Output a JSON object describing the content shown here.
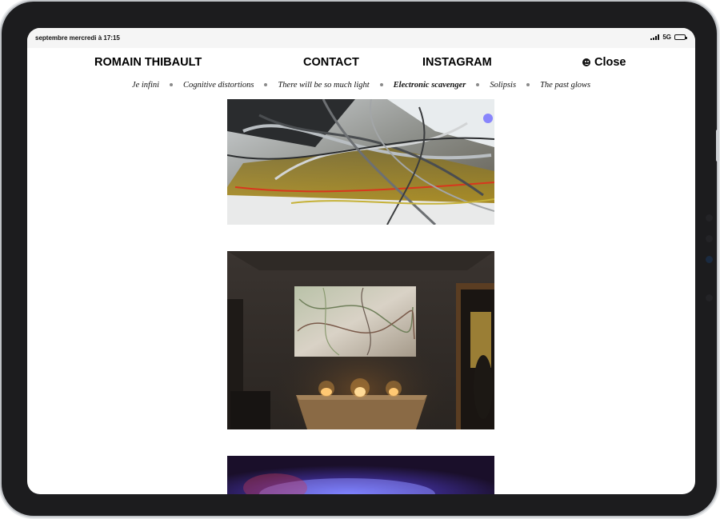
{
  "status_bar": {
    "time": "septembre mercredi à 17:15",
    "network": "5G",
    "icons": [
      "signal-icon",
      "battery-icon"
    ]
  },
  "nav": {
    "brand": "ROMAIN THIBAULT",
    "contact": "CONTACT",
    "instagram": "INSTAGRAM",
    "close_label": "Close",
    "close_icon": "smiley-icon"
  },
  "subnav": {
    "items": [
      {
        "label": "Je infini",
        "active": false
      },
      {
        "label": "Cognitive distortions",
        "active": false
      },
      {
        "label": "There will be so much light",
        "active": false
      },
      {
        "label": "Electronic scavenger",
        "active": true
      },
      {
        "label": "Solipsis",
        "active": false
      },
      {
        "label": "The past glows",
        "active": false
      }
    ]
  },
  "colors": {
    "device_frame": "#1c1c1e",
    "separator_dot": "#8a8a8a",
    "text": "#000000"
  }
}
